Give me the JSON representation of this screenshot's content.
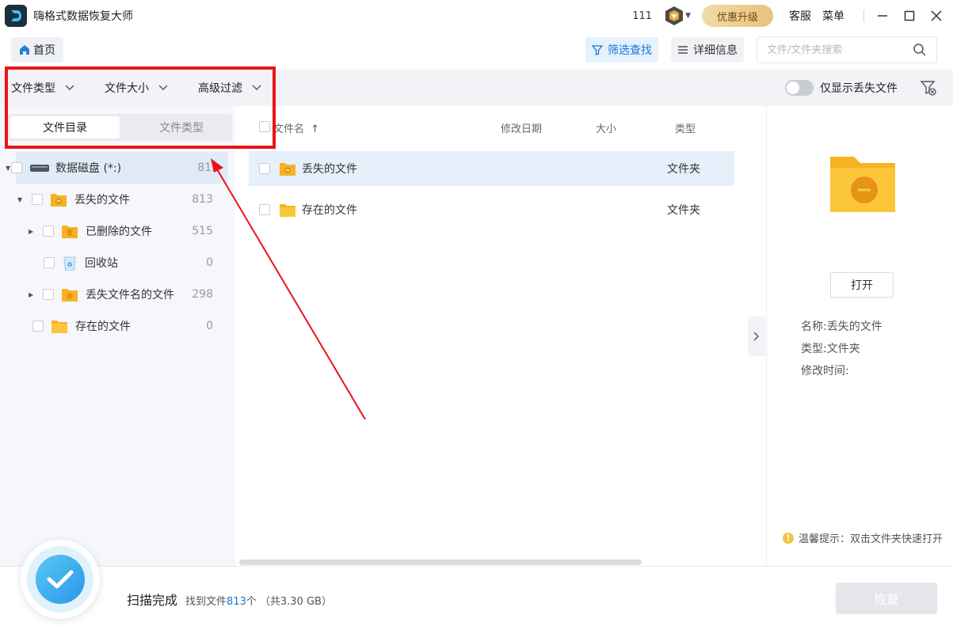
{
  "app": {
    "title": "嗨格式数据恢复大师"
  },
  "titlebar": {
    "count": "111",
    "upgrade_label": "优惠升级",
    "service_label": "客服",
    "menu_label": "菜单"
  },
  "toolbar": {
    "home_label": "首页",
    "filter_label": "筛选查找",
    "detail_label": "详细信息",
    "search_placeholder": "文件/文件夹搜索"
  },
  "filterbar": {
    "dropdowns": [
      {
        "label": "文件类型"
      },
      {
        "label": "文件大小"
      },
      {
        "label": "高级过滤"
      }
    ],
    "toggle_label": "仅显示丢失文件"
  },
  "leftpanel": {
    "tabs": [
      {
        "label": "文件目录"
      },
      {
        "label": "文件类型"
      }
    ],
    "tree": [
      {
        "label": "数据磁盘 (*:)",
        "count": "813"
      },
      {
        "label": "丢失的文件",
        "count": "813"
      },
      {
        "label": "已删除的文件",
        "count": "515"
      },
      {
        "label": "回收站",
        "count": "0"
      },
      {
        "label": "丢失文件名的文件",
        "count": "298"
      },
      {
        "label": "存在的文件",
        "count": "0"
      }
    ]
  },
  "list": {
    "columns": {
      "name": "文件名",
      "modified": "修改日期",
      "size": "大小",
      "type": "类型"
    },
    "rows": [
      {
        "name": "丢失的文件",
        "type": "文件夹"
      },
      {
        "name": "存在的文件",
        "type": "文件夹"
      }
    ]
  },
  "details": {
    "open_label": "打开",
    "name_line": "名称:丢失的文件",
    "type_line": "类型:文件夹",
    "mtime_line": "修改时间:",
    "tip": "温馨提示：双击文件夹快速打开"
  },
  "status": {
    "title": "扫描完成",
    "prefix": "找到文件",
    "count": "813",
    "suffix": "个",
    "total": "（共3.30 GB）",
    "restore_label": "恢复"
  },
  "colors": {
    "accent": "#1677d2",
    "annotation": "#e8141a",
    "folder": "#f5b323"
  }
}
